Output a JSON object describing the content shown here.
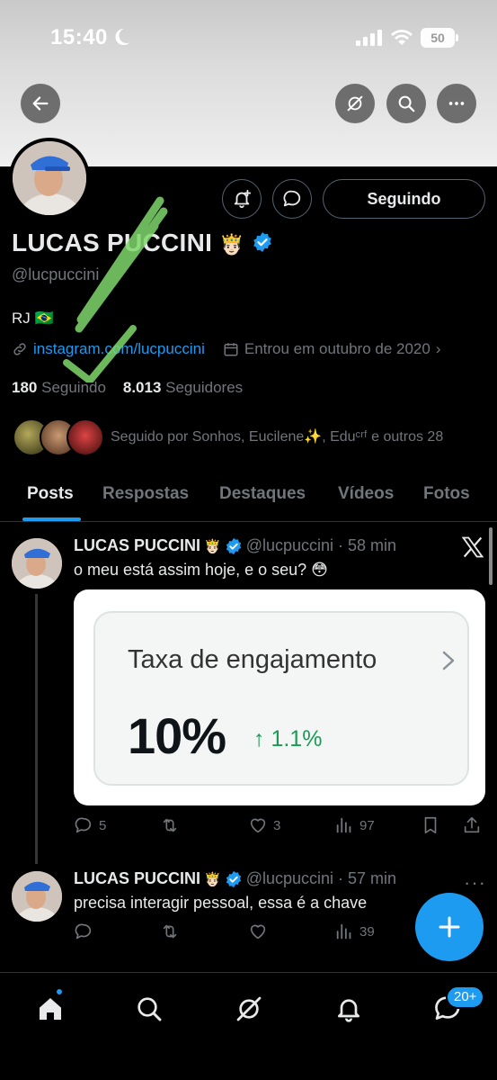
{
  "status_bar": {
    "time": "15:40",
    "battery": "50"
  },
  "profile": {
    "name": "LUCAS PUCCINI",
    "name_emoji": "🤴🏻",
    "handle": "@lucpuccini",
    "bio": "RJ 🇧🇷",
    "link": "instagram.com/lucpuccini",
    "joined": "Entrou em outubro de 2020",
    "following_count": "180",
    "following_label": "Seguindo",
    "followers_count": "8.013",
    "followers_label": "Seguidores",
    "followed_by": "Seguido por Sonhos, Eucilene✨, Eduᶜʳᶠ e outros 28",
    "following_button": "Seguindo"
  },
  "tabs": [
    "Posts",
    "Respostas",
    "Destaques",
    "Vídeos",
    "Fotos"
  ],
  "tweets": [
    {
      "name": "LUCAS PUCCINI",
      "emoji": "🤴🏻",
      "meta": "@lucpuccini · 58 min",
      "text": "o meu está assim hoje, e o seu? 😳",
      "card": {
        "title": "Taxa de engajamento",
        "value": "10%",
        "change": "↑ 1.1%"
      },
      "replies": "5",
      "retweets": "",
      "likes": "3",
      "views": "97"
    },
    {
      "name": "LUCAS PUCCINI",
      "emoji": "🤴🏻",
      "meta": "@lucpuccini · 57 min",
      "text": "precisa interagir pessoal, essa é a chave",
      "replies": "",
      "retweets": "",
      "likes": "",
      "views": "39"
    }
  ],
  "nav": {
    "messages_badge": "20+"
  },
  "colors": {
    "accent": "#1d9bf0",
    "background": "#000000",
    "muted": "#71767b",
    "positive": "#1a9a54"
  }
}
